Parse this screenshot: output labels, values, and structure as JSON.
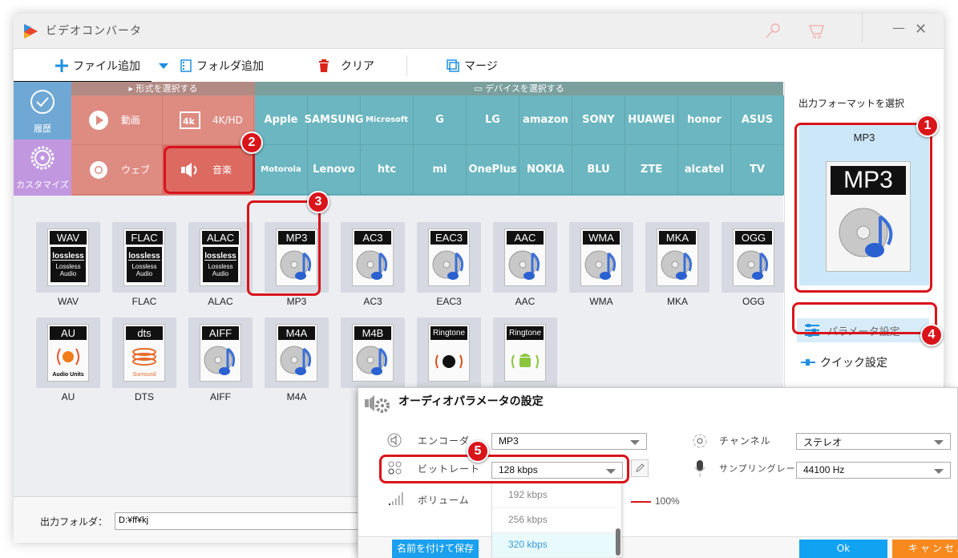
{
  "window": {
    "title": "ビデオコンバータ",
    "icons": [
      "key-icon",
      "cart-icon"
    ],
    "minimize_glyph": "—",
    "close_glyph": "✕"
  },
  "toolbar": {
    "add_file": "ファイル追加",
    "add_folder": "フォルダ追加",
    "clear": "クリア",
    "merge": "マージ"
  },
  "sidebar": {
    "history": "履歴",
    "customize": "カスタマイズ"
  },
  "format_section": {
    "header": "形式を選択する",
    "items": [
      {
        "label": "動画",
        "icon": "play-icon"
      },
      {
        "label": "4K/HD",
        "icon": "4k-icon"
      },
      {
        "label": "ウェブ",
        "icon": "chrome-icon"
      },
      {
        "label": "音楽",
        "icon": "speaker-icon",
        "selected": true
      }
    ]
  },
  "device_section": {
    "header": "デバイスを選択する",
    "row1": [
      "Apple",
      "SAMSUNG",
      "Microsoft",
      "G",
      "LG",
      "amazon",
      "SONY",
      "HUAWEI",
      "honor",
      "ASUS"
    ],
    "row2": [
      "Motorola",
      "Lenovo",
      "htc",
      "mi",
      "OnePlus",
      "NOKIA",
      "BLU",
      "ZTE",
      "alcatel",
      "TV"
    ]
  },
  "audio_formats": {
    "row1": [
      {
        "badge": "WAV",
        "label": "WAV",
        "kind": "lossless"
      },
      {
        "badge": "FLAC",
        "label": "FLAC",
        "kind": "lossless"
      },
      {
        "badge": "ALAC",
        "label": "ALAC",
        "kind": "lossless"
      },
      {
        "badge": "MP3",
        "label": "MP3",
        "kind": "disc",
        "selected": true
      },
      {
        "badge": "AC3",
        "label": "AC3",
        "kind": "disc"
      },
      {
        "badge": "EAC3",
        "label": "EAC3",
        "kind": "disc"
      },
      {
        "badge": "AAC",
        "label": "AAC",
        "kind": "disc"
      },
      {
        "badge": "WMA",
        "label": "WMA",
        "kind": "disc"
      },
      {
        "badge": "MKA",
        "label": "MKA",
        "kind": "disc"
      },
      {
        "badge": "OGG",
        "label": "OGG",
        "kind": "disc"
      }
    ],
    "row2": [
      {
        "badge": "AU",
        "label": "AU",
        "kind": "au",
        "sub": "Audio Units"
      },
      {
        "badge": "dts",
        "label": "DTS",
        "kind": "dts",
        "sub": "Surround"
      },
      {
        "badge": "AIFF",
        "label": "AIFF",
        "kind": "disc"
      },
      {
        "badge": "M4A",
        "label": "M4A",
        "kind": "disc"
      },
      {
        "badge": "M4B",
        "label": "M4B",
        "kind": "disc"
      },
      {
        "badge": "Ringtone",
        "label": "Ringtone",
        "kind": "apple"
      },
      {
        "badge": "Ringtone",
        "label": "Ringtone",
        "kind": "android"
      }
    ],
    "lossless_text": [
      "lossless",
      "Lossless",
      "Audio"
    ]
  },
  "output_folder": {
    "label": "出力フォルダ：",
    "value": "D:¥ff¥kj"
  },
  "right_panel": {
    "title": "出力フォーマットを選択",
    "selected_format": "MP3",
    "param_settings": "パラメータ設定",
    "quick_settings": "クイック設定"
  },
  "dialog": {
    "title": "オーディオパラメータの設定",
    "encoder_label": "エンコーダ",
    "encoder_value": "MP3",
    "bitrate_label": "ビットレート",
    "bitrate_value": "128 kbps",
    "bitrate_options": [
      "192 kbps",
      "256 kbps",
      "320 kbps"
    ],
    "volume_label": "ボリューム",
    "volume_value": "100%",
    "channel_label": "チャンネル",
    "channel_value": "ステレオ",
    "samplerate_label": "サンプリングレート",
    "samplerate_value": "44100 Hz",
    "save_as": "名前を付けて保存",
    "ok": "Ok",
    "cancel": "キャンセル"
  },
  "annotations": [
    "1",
    "2",
    "3",
    "4",
    "5"
  ],
  "colors": {
    "highlight_red": "#d9141b",
    "format_panel": "#de8b82",
    "device_panel": "#6bb6c0",
    "history": "#6fa8d4",
    "customize": "#c197e0",
    "selected_card": "#cce8f8",
    "ok_blue": "#12a2f2",
    "cancel_orange": "#f7891f"
  }
}
